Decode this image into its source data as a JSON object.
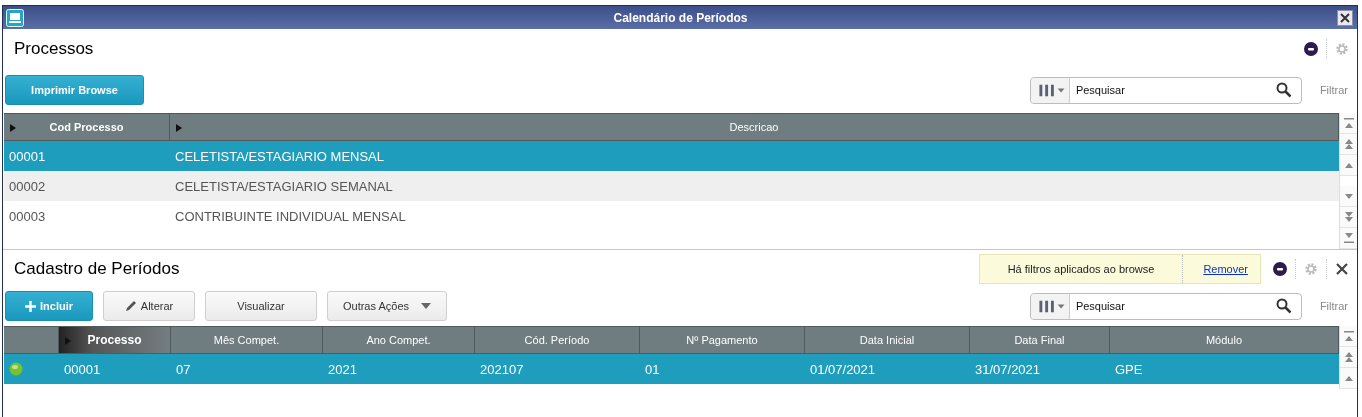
{
  "window": {
    "title": "Calendário de Períodos"
  },
  "top": {
    "title": "Processos",
    "buttons": [
      {
        "label": "Imprimir Browse",
        "kind": "primary"
      }
    ],
    "search": {
      "placeholder": "Pesquisar"
    },
    "filter": "Filtrar",
    "columns": [
      {
        "label": "Cod Processo",
        "arrow": true,
        "sorted": false
      },
      {
        "label": "Descricao",
        "arrow": true,
        "sorted": false
      }
    ],
    "rows": [
      {
        "selected": true,
        "cells": [
          "00001",
          "CELETISTA/ESTAGIARIO MENSAL"
        ]
      },
      {
        "selected": false,
        "cells": [
          "00002",
          "CELETISTA/ESTAGIARIO SEMANAL"
        ]
      },
      {
        "selected": false,
        "cells": [
          "00003",
          "CONTRIBUINTE INDIVIDUAL MENSAL"
        ]
      }
    ]
  },
  "bottom": {
    "title": "Cadastro de Períodos",
    "notice": {
      "text": "Há filtros aplicados ao browse",
      "link": "Remover"
    },
    "buttons": [
      {
        "label": "Incluir",
        "kind": "primary"
      },
      {
        "label": "Alterar",
        "kind": "edit"
      },
      {
        "label": "Visualizar",
        "kind": "plain"
      },
      {
        "label": "Outras Ações",
        "kind": "menu"
      }
    ],
    "search": {
      "placeholder": "Pesquisar"
    },
    "filter": "Filtrar",
    "columns": [
      {
        "label": "Processo",
        "arrow": true,
        "sorted": true
      },
      {
        "label": "Mês Compet.",
        "arrow": false,
        "sorted": false
      },
      {
        "label": "Ano Compet.",
        "arrow": false,
        "sorted": false
      },
      {
        "label": "Cód. Período",
        "arrow": false,
        "sorted": false
      },
      {
        "label": "Nº Pagamento",
        "arrow": false,
        "sorted": false
      },
      {
        "label": "Data Inicial",
        "arrow": false,
        "sorted": false
      },
      {
        "label": "Data Final",
        "arrow": false,
        "sorted": false
      },
      {
        "label": "Módulo",
        "arrow": false,
        "sorted": false
      }
    ],
    "rows": [
      {
        "selected": true,
        "color": "#7ac22c",
        "cells": [
          "00001",
          "07",
          "2021",
          "202107",
          "01",
          "01/07/2021",
          "31/07/2021",
          "GPE"
        ]
      }
    ]
  }
}
